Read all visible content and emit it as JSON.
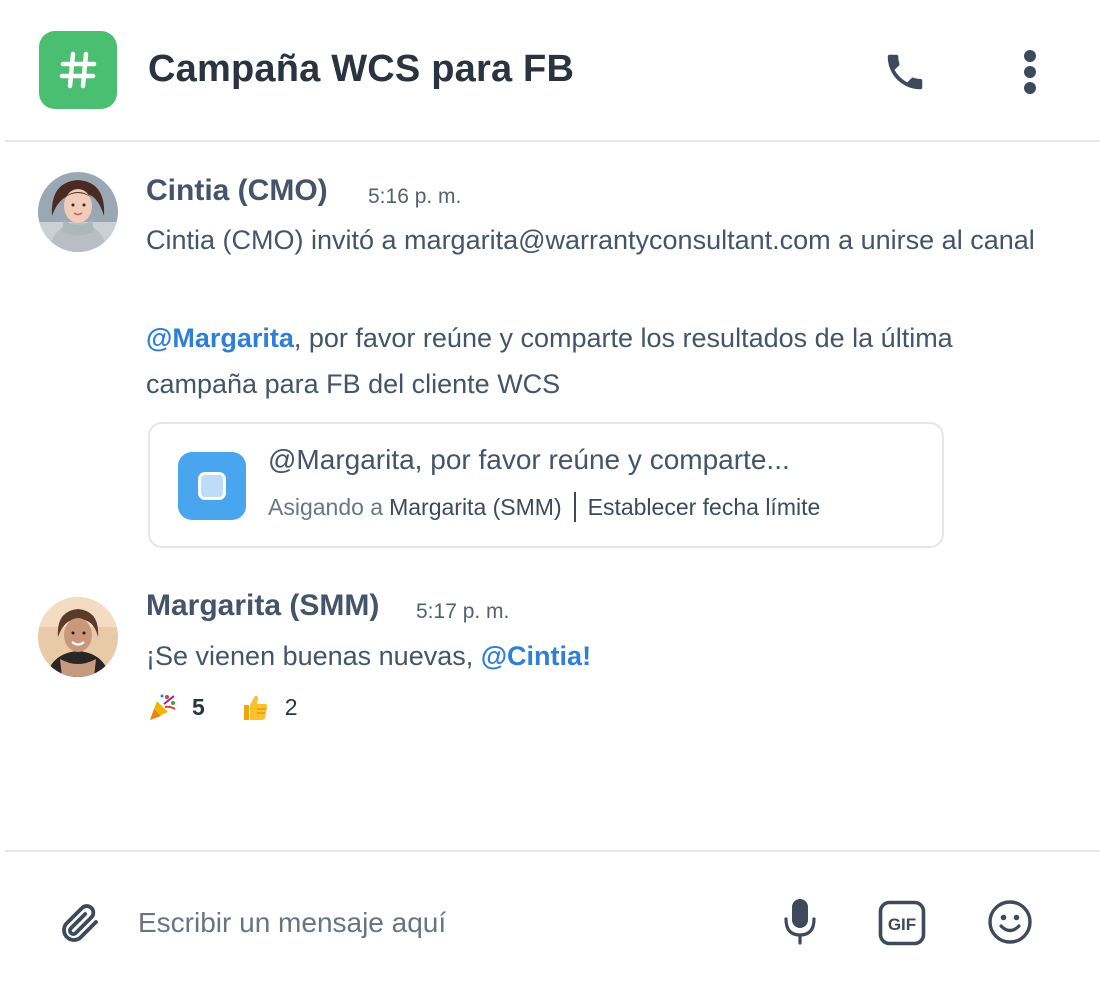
{
  "header": {
    "channel_icon": "hash-icon",
    "title": "Campaña WCS para FB",
    "call_icon": "phone-icon",
    "more_icon": "more-vertical-icon"
  },
  "messages": [
    {
      "author": "Cintia (CMO)",
      "time": "5:16 p. m.",
      "system_text": "Cintia (CMO) invitó a margarita@warrantyconsultant.com a unirse al canal",
      "mention": "@Margarita",
      "text_after_mention": ", por favor reúne y comparte los resultados de la última campaña para FB del cliente WCS",
      "task": {
        "icon": "task-icon",
        "title": "@Margarita, por favor reúne y comparte...",
        "assigned_prefix": "Asigando a",
        "assignee": "Margarita (SMM)",
        "due_action": "Establecer fecha límite"
      }
    },
    {
      "author": "Margarita (SMM)",
      "time": "5:17 p. m.",
      "text_before_mention": "¡Se vienen buenas nuevas, ",
      "mention": "@Cintia!",
      "reactions": [
        {
          "emoji": "party-popper",
          "count": "5"
        },
        {
          "emoji": "thumbs-up",
          "count": "2"
        }
      ]
    }
  ],
  "composer": {
    "placeholder": "Escribir un mensaje aquí",
    "gif_label": "GIF"
  },
  "colors": {
    "channel_badge": "#4bbf71",
    "mention": "#2f7fd8",
    "task_icon": "#49a6ee",
    "text": "#44546a"
  }
}
